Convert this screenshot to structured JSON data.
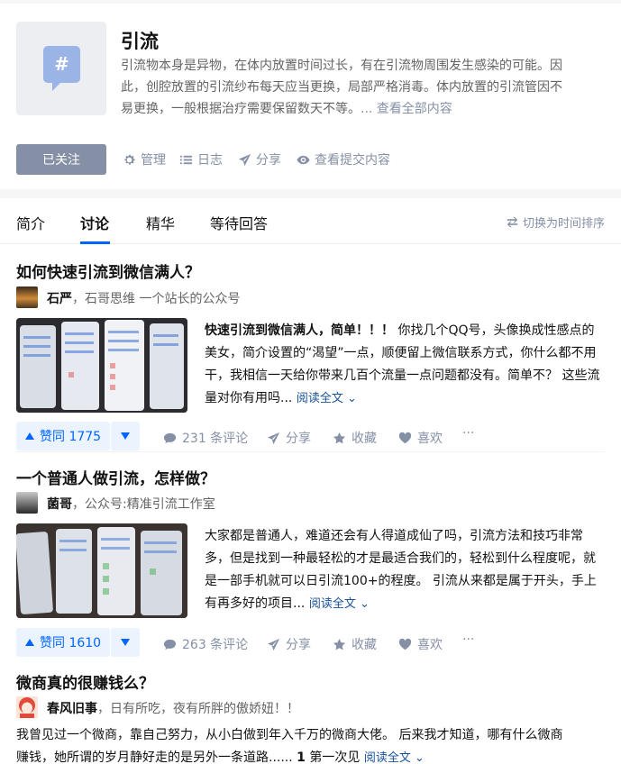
{
  "topic": {
    "title": "引流",
    "description_lines": [
      "引流物本身是异物，在体内放置时间过长，有在引流物周围发生感染的可能。因",
      "此，创腔放置的引流纱布每天应当更换，局部严格消毒。体内放置的引流管因不",
      "易更换，一般根据治疗需要保留数天不等。"
    ],
    "more_link": "... 查看全部内容",
    "avatar_icon": "hash-bubble-icon",
    "avatar_symbol": "#",
    "follow_label": "已关注",
    "actions": [
      {
        "label": "管理",
        "icon": "gear-icon"
      },
      {
        "label": "日志",
        "icon": "list-icon"
      },
      {
        "label": "分享",
        "icon": "paper-plane-icon"
      },
      {
        "label": "查看提交内容",
        "icon": "eye-icon"
      }
    ]
  },
  "tabs": [
    {
      "label": "简介",
      "active": false
    },
    {
      "label": "讨论",
      "active": true
    },
    {
      "label": "精华",
      "active": false
    },
    {
      "label": "等待回答",
      "active": false
    }
  ],
  "sort_toggle": "切换为时间排序",
  "posts": [
    {
      "title": "如何快速引流到微信满人？",
      "author": "石严",
      "author_bio": "，石哥思维 一个站长的公众号",
      "excerpt_bold": "快速引流到微信满人，简单！！！",
      "excerpt": " 你找几个QQ号，头像换成性感点的美女，简介设置的“渴望”一点，顺便留上微信联系方式，你什么都不用干，我相信一天给你带来几百个流量一点问题都没有。简单不？ 这些流量对你有用吗...",
      "read_more": "阅读全文",
      "vote_label": "赞同 1775",
      "comments": "231 条评论",
      "share": "分享",
      "collect": "收藏",
      "like": "喜欢",
      "more": "···"
    },
    {
      "title": "一个普通人做引流，怎样做？",
      "author": "菌哥",
      "author_bio": "，公众号:精准引流工作室",
      "excerpt_bold": "",
      "excerpt": "大家都是普通人，难道还会有人得道成仙了吗，引流方法和技巧非常多，但是找到一种最轻松的才是最适合我们的，轻松到什么程度呢，就是一部手机就可以日引流100+的程度。 引流从来都是属于开头，手上有再多好的项目...",
      "read_more": "阅读全文",
      "vote_label": "赞同 1610",
      "comments": "263 条评论",
      "share": "分享",
      "collect": "收藏",
      "like": "喜欢",
      "more": "···"
    },
    {
      "title": "微商真的很赚钱么？",
      "author": "春风旧事",
      "author_bio": "，日有所吃，夜有所胖的傲娇妞！！",
      "excerpt_line1": "我曾见过一个微商，靠自己努力，从小白做到年入千万的微商大佬。 后来我才知道，哪有什么微商",
      "excerpt_line2": "赚钱，她所谓的岁月静好走的是另外一条道路...... ",
      "excerpt_line2_bold": "1",
      "excerpt_line2_tail": " 第一次见",
      "read_more": "阅读全文"
    }
  ],
  "colors": {
    "brand_blue": "#0066ff",
    "muted": "#8590a6",
    "link": "#175199",
    "vote_bg": "#ebf3ff"
  }
}
